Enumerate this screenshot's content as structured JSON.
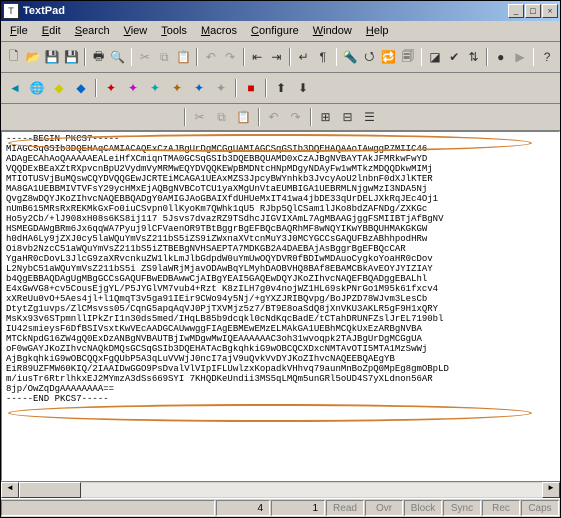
{
  "titlebar": {
    "title": "TextPad"
  },
  "menu": {
    "items": [
      "File",
      "Edit",
      "Search",
      "View",
      "Tools",
      "Macros",
      "Configure",
      "Window",
      "Help"
    ]
  },
  "status": {
    "line": "4",
    "col": "1",
    "flags": [
      "Read",
      "Ovr",
      "Block",
      "Sync",
      "Rec",
      "Caps"
    ]
  },
  "content": "-----BEGIN PKCS7-----\nMIAGCSqGSIb3DQEHAqCAMIACAQExCzAJBgUrDgMCGgUAMIAGCSqGSIb3DQEHAQAAoIAwggP7MIIC46\nADAgECAhAoQAAAAAEALeiHfXCmiqnTMA0GCSqGSIb3DQEBBQUAMD0xCzAJBgNVBAYTAkJFMRkwFwYD\nVQQDExBEaXZtRXpvcnBpU2VydmVyMRMwEQYDVQQKEWpBMDNtcHNpMDgyNDAyFw1wMTkzMDQQDkwMIMj\nMTIOTUSVjBuMQswCQYDVQQGEwJCRTEiMCAGA1UEAxMZS3JpcyBWYnhkb3JvcyAoU2lnbnF0dXJlKTER\nMA8GA1UEBBMIVTVFsY29ycHMxEjAQBgNVBCoTCU1yaXMgUnVtaEUMBIGA1UEBRMLNjgwMzI3NDA5Nj\nQvgZ8wDQYJKoZIhvcNAQEBBQADgY0AMIGJAoGBAIXfdUHUeMxIT41wa4jbDE33qUrDELJXkRqJEc4Oj1\nnUmB615MRsRxREKMkGxFo0iuCSvpn0llKyoKm7QWhk1qU5 RJbp5QlCSam1lJKo8bdZAFNDg/ZXKGc\nHo5y2Cb/+lJ908xH08s6KS8ij117 5Jsvs7dvazRZ9TSdhcJIGVIXAmL7AgMBAAGjggFSMIIBTjAfBgNV\nHSMEGDAWgBRm6Jx6qqWA7Pyuj9lCFVaenOR9TBtBggrBgEFBQcBAQRhMF8wNQYIKwYBBQUHMAKGKGW\nh0dHA6Ly9jZXJ0cy5laWQuYmVsZ211bS5iZS9iZWxnaXVtcnMuY3J0MCYGCCsGAQUFBzABhhpodHRw\nOi8vb2NzcC51aWQuYmVsZ211bS5iZTBEBgNVHSAEPTA7MDKGB2A4DAEBAjAsBggrBgEFBQcCAR\nYgaHR0cDovL3JlcG9zaXRvcnkuZW1lkLmJlbGdpdW0uYmUwOQYDVR0fBDIwMDAuoCygkoYoaHR0cDov\nL2NybC51aWQuYmVsZ211bS5i ZS9laWRjMjavODAwBqYLMyhDAOBVHQ8BAf8EBAMCBkAvEOYJYIZIAY\nb4QgEBBAQDAgUgMBgGCCsGAQUFBwEDBAwwCjAIBgYEAI5GAQEwDQYJKoZIhvcNAQEFBQADggEBALhl\nE4xGwVG8+cv5CousEjgYL/P5JYGlVM7vub4+Rzt K8zILH7g0v4nojWZ1HL69skPNrGo1M95k61fxcv4\nxXReUu0vO+5Aes4jl+l1QmqT3v5ga91IEir9CWo94y5Nj/+gYXZJRIBQvpg/BoJPZD78WJvm3LesCb\nDtytZg1uvps/ZlCMsvss05/CqnG5apqAqVJ0PjTXVMjz5z7/BT9E8oaSdQ8jXnVKU3AKLR5gF9H1xQRY\nMsKx93v6STpmnllIPkZrI1n30ds5med/IHqLB85b9dcqkl0cNdKqcBadE/tCTahDRUNFZslJrEL7190bl\nIU42smieysF6DfBSIVsxtKwVEcAADGCAUwwggFIAgEBMEwEMzELMAkGA1UEBhMCQkUxEzARBgNVBA\nMTCkNpdG16ZW4gQ0ExDzANBgNVBAUTBjIwMDgwMwIQEAAAAAAC3oh31wvoqpk2TAJBgUrDgMCGgUA\noF0wGAYJKoZIhvcNAQkDMQsGCSqGSIb3DQEHATAcBgkqhkiG9wOBCQCXDxcNMTAvOTI5MTA1MzSwWj\nAjBgkqhkiG9wOBCQQxFgQUbP5A3qLuVVWjJ0ncI7ajV9uQvkVvDYJKoZIhvcNAQEEBQAEgYB\nEiR89UZFMW60KIQ/2IAAIDwGGO9PsDvalVlVIpIFLUwlzxKopadkVHhvq79aunMnBoZpQ0MpEg8gmOBpLD\nm/iusTr6RtrlhkxEJ2MYmzA3dSs669SYI 7KHQDKeUndii3MS5qLMQm5unGRl5oUD4S7yXLdnon56AR\n8jp/OwZqDgAAAAAAAA==\n-----END PKCS7-----"
}
